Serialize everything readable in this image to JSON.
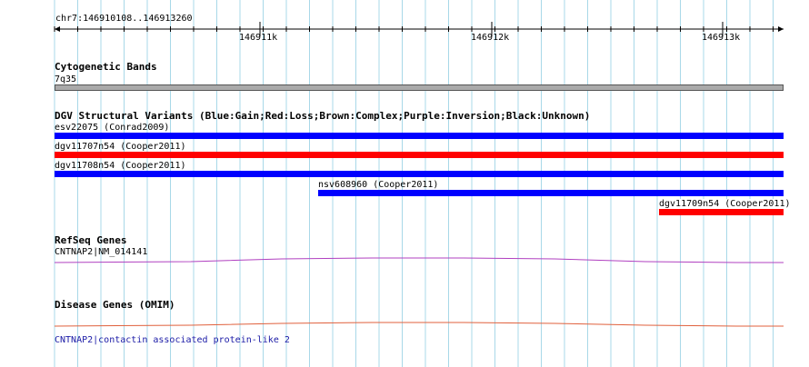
{
  "ruler": {
    "location": "chr7:146910108..146913260",
    "ticks": [
      "146911k",
      "146912k",
      "146913k"
    ]
  },
  "tracks": {
    "cytoband": {
      "title": "Cytogenetic Bands",
      "band": "7q35",
      "color": "#aaaaaa"
    },
    "dgv": {
      "title": "DGV Structural Variants (Blue:Gain;Red:Loss;Brown:Complex;Purple:Inversion;Black:Unknown)",
      "variants": [
        {
          "label": "esv22075 (Conrad2009)",
          "color": "#0000ff"
        },
        {
          "label": "dgv11707n54 (Cooper2011)",
          "color": "#ff0000"
        },
        {
          "label": "dgv11708n54 (Cooper2011)",
          "color": "#0000ff"
        },
        {
          "label": "nsv608960 (Cooper2011)",
          "color": "#0000ff"
        },
        {
          "label": "dgv11709n54 (Cooper2011)",
          "color": "#ff0000"
        }
      ]
    },
    "refseq": {
      "title": "RefSeq Genes",
      "gene": "CNTNAP2|NM_014141",
      "color": "#b040c0"
    },
    "omim": {
      "title": "Disease Genes (OMIM)",
      "gene": "CNTNAP2|contactin associated protein-like 2",
      "color": "#e0603c"
    }
  },
  "colors": {
    "gridline": "#a8d8e8",
    "ruler": "#000000"
  }
}
